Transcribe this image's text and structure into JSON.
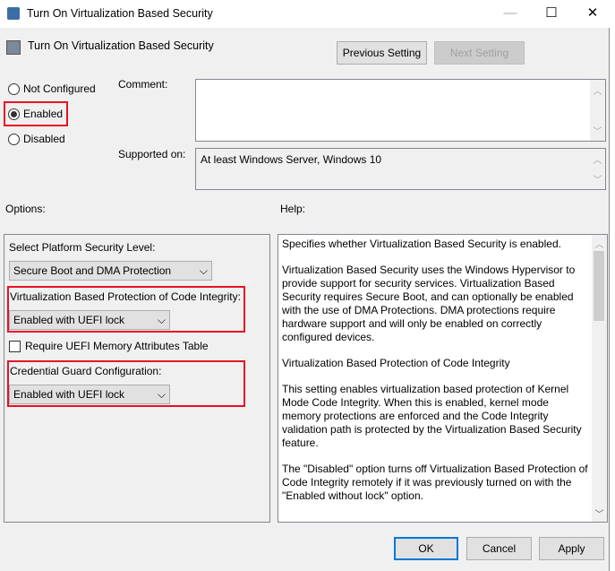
{
  "window": {
    "title": "Turn On Virtualization Based Security",
    "minimize": "—",
    "maximize": "☐",
    "close": "✕"
  },
  "header": {
    "setting_name": "Turn On Virtualization Based Security",
    "previous": "Previous Setting",
    "next": "Next Setting"
  },
  "state": {
    "options": [
      "Not Configured",
      "Enabled",
      "Disabled"
    ],
    "selected": "Enabled"
  },
  "comment": {
    "label": "Comment:",
    "value": ""
  },
  "supported": {
    "label": "Supported on:",
    "value": "At least Windows Server, Windows 10"
  },
  "options_label": "Options:",
  "help_label": "Help:",
  "options": {
    "platform_label": "Select Platform Security Level:",
    "platform_value": "Secure Boot and DMA Protection",
    "vbs_ci_label": "Virtualization Based Protection of Code Integrity:",
    "vbs_ci_value": "Enabled with UEFI lock",
    "uefi_mat_label": "Require UEFI Memory Attributes Table",
    "uefi_mat_checked": false,
    "cg_label": "Credential Guard Configuration:",
    "cg_value": "Enabled with UEFI lock"
  },
  "help": [
    "Specifies whether Virtualization Based Security is enabled.",
    "Virtualization Based Security uses the Windows Hypervisor to provide support for security services. Virtualization Based Security requires Secure Boot, and can optionally be enabled with the use of DMA Protections. DMA protections require hardware support and will only be enabled on correctly configured devices.",
    "Virtualization Based Protection of Code Integrity",
    "This setting enables virtualization based protection of Kernel Mode Code Integrity. When this is enabled, kernel mode memory protections are enforced and the Code Integrity validation path is protected by the Virtualization Based Security feature.",
    "The \"Disabled\" option turns off Virtualization Based Protection of Code Integrity remotely if it was previously turned on with the \"Enabled without lock\" option."
  ],
  "footer": {
    "ok": "OK",
    "cancel": "Cancel",
    "apply": "Apply"
  },
  "colors": {
    "highlight": "#e81123",
    "focus": "#0078d7"
  }
}
